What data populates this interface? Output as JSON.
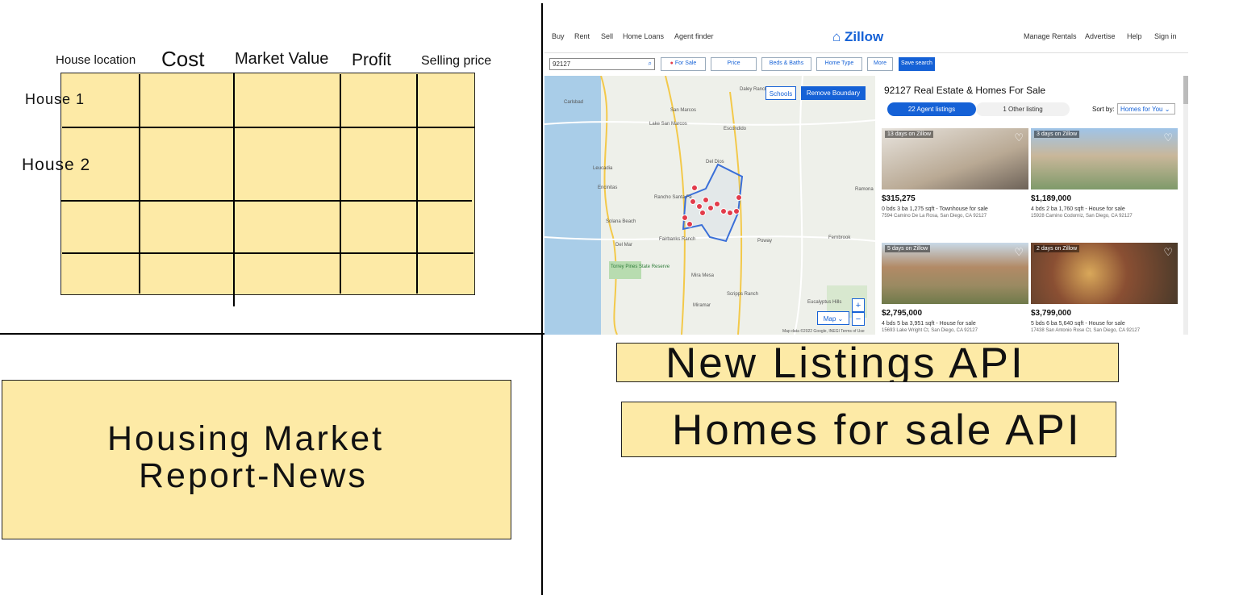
{
  "spreadsheet": {
    "headers": [
      "House location",
      "Cost",
      "Market Value",
      "Profit",
      "Selling price"
    ],
    "rows": [
      "House 1",
      "House 2"
    ]
  },
  "report_box": {
    "line1": "Housing Market",
    "line2": "Report-News"
  },
  "api_labels": {
    "new_listings": "New Listings API",
    "homes_for_sale": "Homes for sale API"
  },
  "zillow": {
    "nav_left": [
      "Buy",
      "Rent",
      "Sell",
      "Home Loans",
      "Agent finder"
    ],
    "logo": "Zillow",
    "nav_right": [
      "Manage Rentals",
      "Advertise",
      "Help",
      "Sign in"
    ],
    "search_value": "92127",
    "filters": [
      "For Sale",
      "Price",
      "Beds & Baths",
      "Home Type",
      "More"
    ],
    "save_search": "Save search",
    "map_buttons": {
      "schools": "Schools",
      "remove_boundary": "Remove Boundary",
      "map_type": "Map",
      "zoom_in": "+",
      "zoom_out": "−"
    },
    "map_places": [
      "Carlsbad",
      "San Marcos",
      "Escondido",
      "Lake San Marcos",
      "Daley Ranch",
      "Leucadia",
      "Encinitas",
      "Rancho Santa Fe",
      "Solana Beach",
      "Del Mar",
      "Fairbanks Ranch",
      "Del Dios",
      "Poway",
      "Torrey Pines State Reserve",
      "Mira Mesa",
      "Scripps Ranch",
      "Miramar",
      "Eucalyptus Hills",
      "Ramona",
      "Fernbrook"
    ],
    "list_title": "92127 Real Estate & Homes For Sale",
    "tabs": [
      "22 Agent listings",
      "1 Other listing"
    ],
    "sort_label": "Sort by:",
    "sort_value": "Homes for You",
    "listings": [
      {
        "badge": "13 days on Zillow",
        "price": "$315,275",
        "detail": "0 bds  3 ba  1,275 sqft - Townhouse for sale",
        "address": "7594 Camino De La Rosa, San Diego, CA 92127",
        "photo": "#b9a994"
      },
      {
        "badge": "3 days on Zillow",
        "price": "$1,189,000",
        "detail": "4 bds  2 ba  1,760 sqft - House for sale",
        "address": "15928 Camino Codorniz, San Diego, CA 92127",
        "photo": "#7f9a6a"
      },
      {
        "badge": "5 days on Zillow",
        "price": "$2,795,000",
        "detail": "4 bds  5 ba  3,951 sqft - House for sale",
        "address": "15693 Lake Wright Ct, San Diego, CA 92127",
        "photo": "#9a8a62"
      },
      {
        "badge": "2 days on Zillow",
        "price": "$3,799,000",
        "detail": "5 bds  6 ba  5,640 sqft - House for sale",
        "address": "17438 San Antonio Rose Ct, San Diego, CA 92127",
        "photo": "#6b4a35"
      }
    ],
    "map_footer": "Map data ©2022 Google, INEGI  Terms of Use"
  }
}
